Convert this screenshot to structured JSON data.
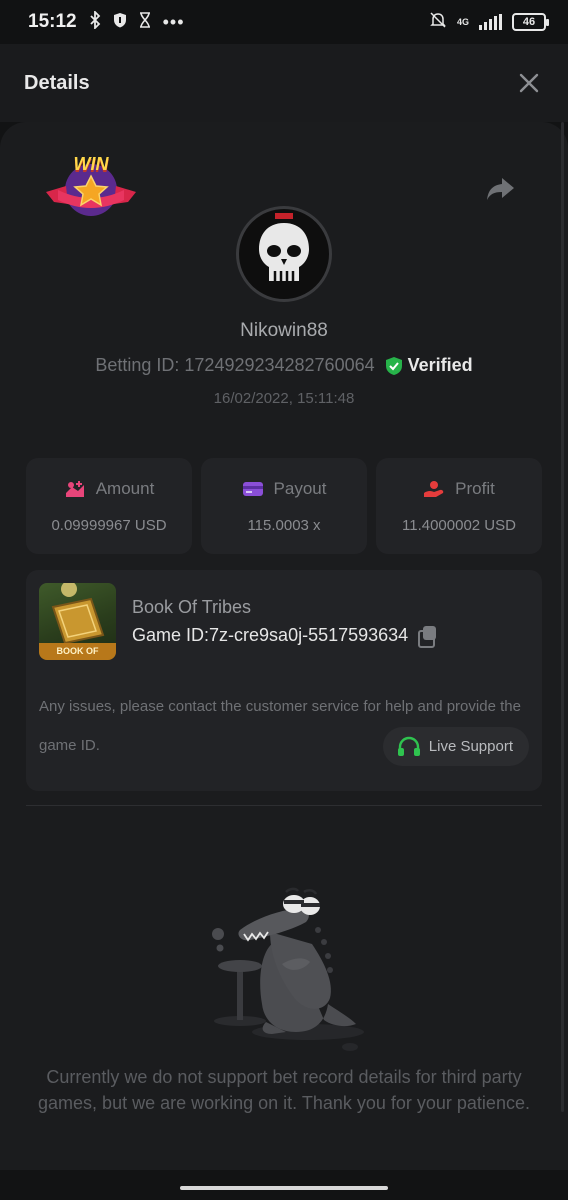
{
  "status_bar": {
    "time": "15:12",
    "battery": "46",
    "network": "4G"
  },
  "header": {
    "title": "Details"
  },
  "profile": {
    "username": "Nikowin88",
    "betting_id_label": "Betting ID:",
    "betting_id": "1724929234282760064",
    "verified_label": "Verified",
    "datetime": "16/02/2022, 15:11:48",
    "badge_text": "WIN"
  },
  "stats": {
    "amount": {
      "label": "Amount",
      "value": "0.09999967 USD"
    },
    "payout": {
      "label": "Payout",
      "value": "115.0003 x"
    },
    "profit": {
      "label": "Profit",
      "value": "11.4000002 USD"
    }
  },
  "game": {
    "name": "Book Of Tribes",
    "id_label": "Game ID:",
    "id": "7z-cre9sa0j-5517593634",
    "thumb_caption": "BOOK OF TRIBES",
    "issue_text": "Any issues, please contact the customer service for help and provide the game ID.",
    "support_label": "Live Support"
  },
  "notice": "Currently we do not support bet record details for third party games, but we are working on it. Thank you for your patience.",
  "colors": {
    "background": "#121314",
    "card": "#222326",
    "verified_green": "#27b34a",
    "amount_pink": "#e8457a",
    "payout_purple": "#8b4fd8",
    "profit_red": "#e53c3c",
    "support_green": "#2fc34f"
  }
}
